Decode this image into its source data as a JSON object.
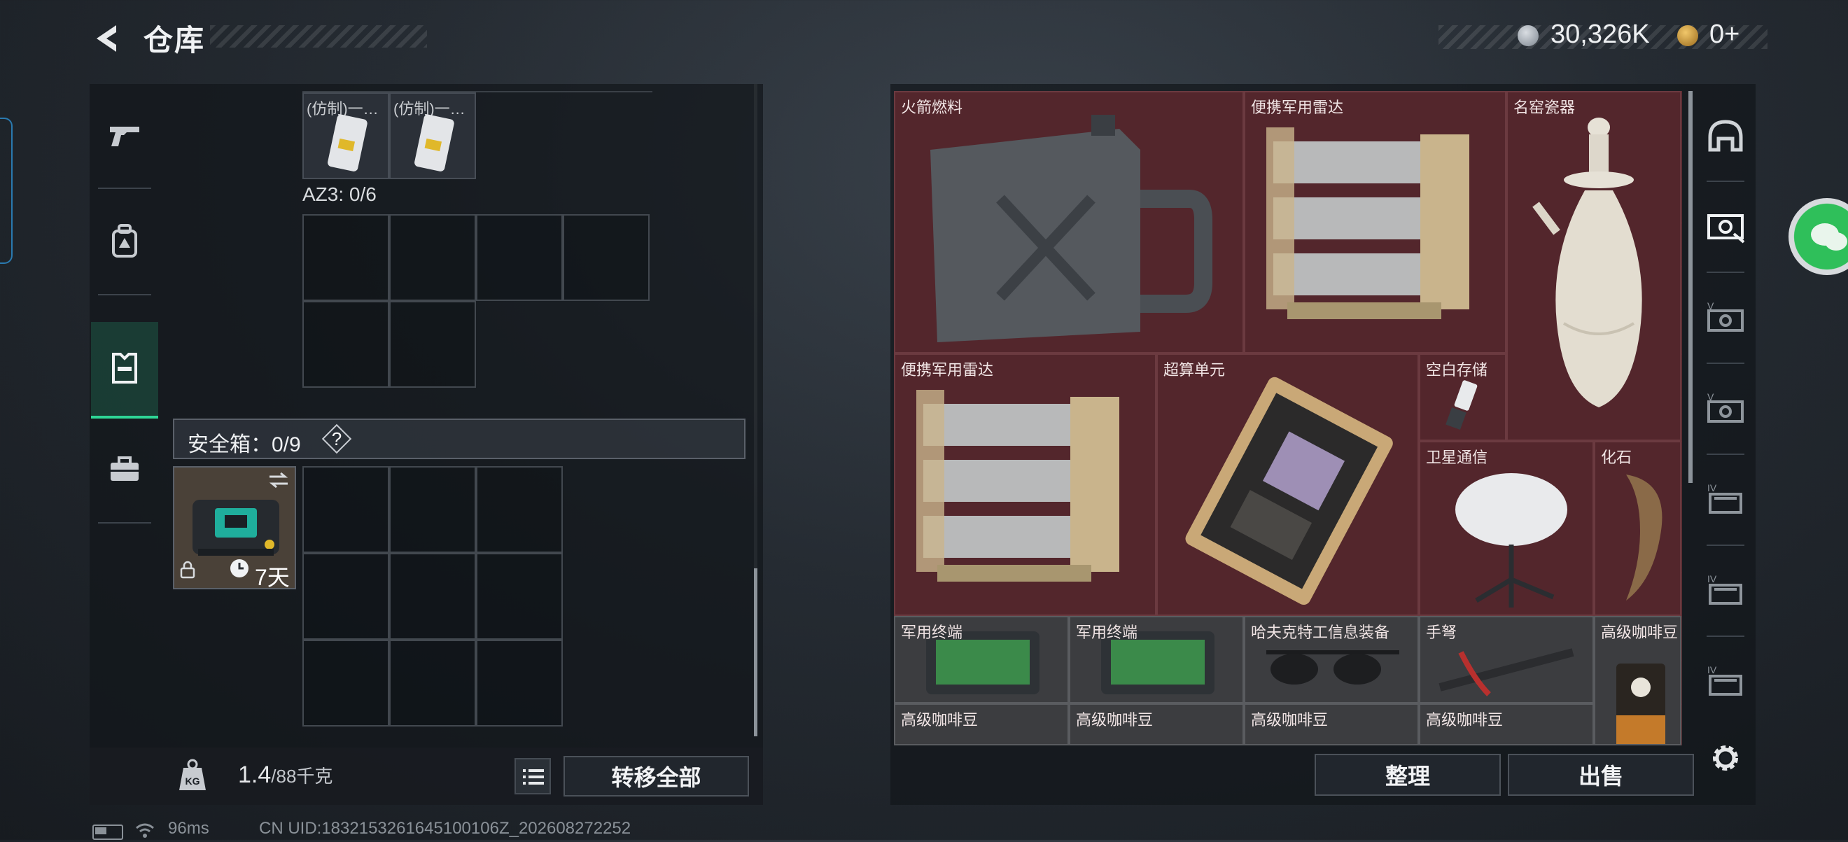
{
  "header": {
    "title": "仓库",
    "back_icon": "back-arrow-icon",
    "currency1": {
      "icon": "silver-coin-icon",
      "value": "30,326K"
    },
    "currency2": {
      "icon": "gold-triangle-coin-icon",
      "value": "0+"
    }
  },
  "left_tabs": [
    {
      "icon": "pistol-icon",
      "active": false
    },
    {
      "icon": "backpack-icon",
      "active": false
    },
    {
      "icon": "vest-icon",
      "active": true
    },
    {
      "icon": "toolbox-icon",
      "active": false
    }
  ],
  "container": {
    "imitation_items": [
      {
        "label": "(仿制)一…"
      },
      {
        "label": "(仿制)一…"
      }
    ],
    "az3_label": "AZ3: 0/6",
    "safe_box_label": "安全箱：0/9",
    "safe_box_help": "?",
    "safe_box_timer": "7天"
  },
  "footer_left": {
    "weight_value": "1.4",
    "weight_unit": "/88千克",
    "transfer_all": "转移全部"
  },
  "stash": {
    "items": [
      {
        "name": "火箭燃料"
      },
      {
        "name": "便携军用雷达"
      },
      {
        "name": "名窑瓷器"
      },
      {
        "name": "便携军用雷达"
      },
      {
        "name": "超算单元"
      },
      {
        "name": "空白存储"
      },
      {
        "name": "卫星通信"
      },
      {
        "name": "化石"
      },
      {
        "name": "军用终端"
      },
      {
        "name": "军用终端"
      },
      {
        "name": "哈夫克特工信息装备"
      },
      {
        "name": "手弩"
      },
      {
        "name": "高级咖啡豆"
      },
      {
        "name": "高级咖啡豆"
      },
      {
        "name": "高级咖啡豆"
      },
      {
        "name": "高级咖啡豆"
      },
      {
        "name": "高级咖啡豆"
      }
    ],
    "sort_label": "整理",
    "sell_label": "出售"
  },
  "right_tabs": [
    "helmet-icon",
    "stash-page-icon",
    "stash-page-v-icon",
    "stash-page-v-icon",
    "stash-page-iv-icon",
    "stash-page-iv-icon",
    "stash-page-iv-icon"
  ],
  "status_bar": {
    "ping": "96ms",
    "uid": "CN UID:1832153261645100106Z_202608272252"
  },
  "colors": {
    "accent_green": "#2ed696",
    "stash_red": "#4a2228"
  }
}
